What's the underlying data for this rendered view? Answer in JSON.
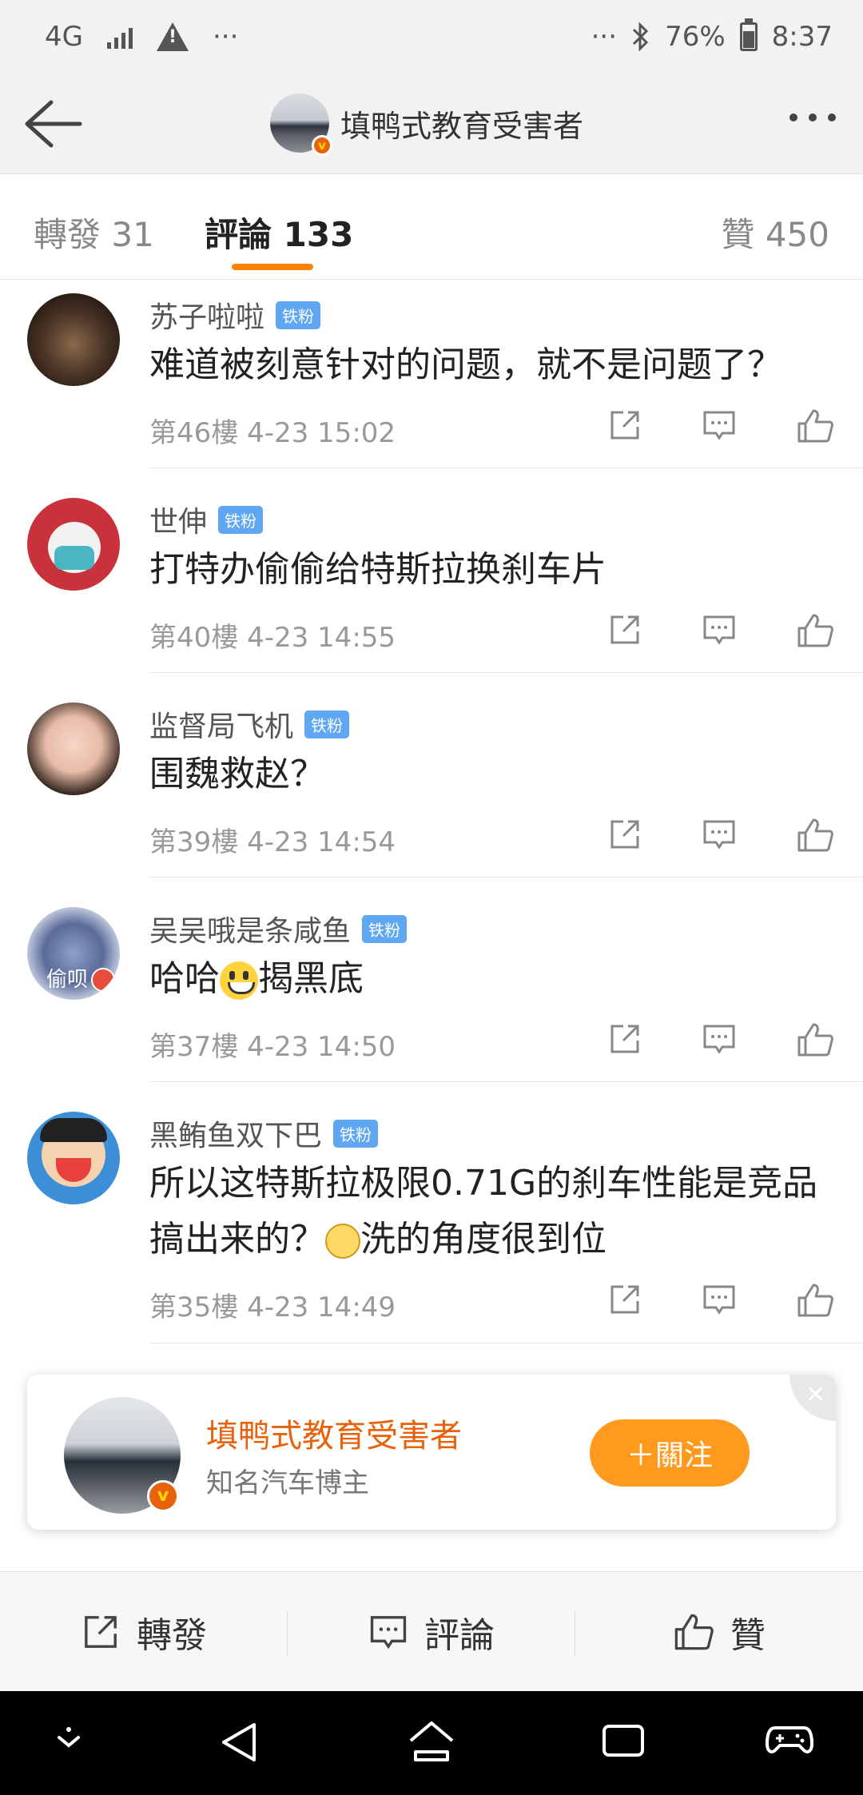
{
  "status_bar": {
    "network": "4G",
    "left_extra": "···",
    "right_extra": "···",
    "battery": "76%",
    "time": "8:37"
  },
  "topnav": {
    "title": "填鸭式教育受害者",
    "badge": "v"
  },
  "tabs": [
    {
      "label": "轉發 31"
    },
    {
      "label": "評論 133"
    },
    {
      "label": "贊 450"
    }
  ],
  "fan_badge": "铁粉",
  "comments": [
    {
      "name": "苏子啦啦",
      "text": "难道被刻意针对的问题，就不是问题了？",
      "floor": "第46樓",
      "time": "4-23 15:02"
    },
    {
      "name": "世伸",
      "text": "打特办偷偷给特斯拉换刹车片",
      "floor": "第40樓",
      "time": "4-23 14:55"
    },
    {
      "name": "监督局飞机",
      "text": "围魏救赵？",
      "floor": "第39樓",
      "time": "4-23 14:54"
    },
    {
      "name": "吴吴哦是条咸鱼",
      "text_a": "哈哈",
      "text_b": "揭黑底",
      "avatar_label": "偷呗",
      "floor": "第37樓",
      "time": "4-23 14:50"
    },
    {
      "name": "黑鲔鱼双下巴",
      "text_a": "所以这特斯拉极限0.71G的刹车性能是竞品",
      "text_b": "搞出来的？",
      "text_c": "洗的角度很到位",
      "floor": "第35樓",
      "time": "4-23 14:49"
    }
  ],
  "follow_card": {
    "name": "填鸭式教育受害者",
    "subtitle": "知名汽车博主",
    "follow_label": "关注",
    "follow_display": "＋關注",
    "close": "×"
  },
  "action_bar": {
    "repost": "轉發",
    "comment": "評論",
    "like": "贊"
  },
  "colors": {
    "accent": "#ff8200",
    "follow_button": "#ff9a1e",
    "verified": "#e8620c",
    "fan_badge": "#5fa7f2"
  }
}
